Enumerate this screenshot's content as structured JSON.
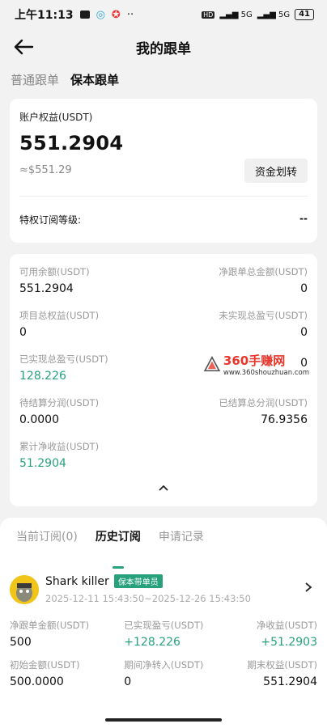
{
  "status_bar": {
    "time": "上午11:13",
    "extra": "··",
    "hd": "HD",
    "signal1": "5G",
    "signal2": "5G",
    "battery": "41"
  },
  "nav": {
    "title": "我的跟单"
  },
  "top_tabs": [
    {
      "label": "普通跟单"
    },
    {
      "label": "保本跟单"
    }
  ],
  "account": {
    "equity_label": "账户权益(USDT)",
    "equity_value": "551.2904",
    "equity_approx": "≈$551.29",
    "transfer_button": "资金划转",
    "tier_label": "特权订阅等级:",
    "tier_value": "--"
  },
  "stats": [
    {
      "left_label": "可用余额(USDT)",
      "left_value": "551.2904",
      "right_label": "净跟单总金额(USDT)",
      "right_value": "0"
    },
    {
      "left_label": "项目总权益(USDT)",
      "left_value": "0",
      "right_label": "未实现总盈亏(USDT)",
      "right_value": "0"
    },
    {
      "left_label": "已实现总盈亏(USDT)",
      "left_value": "128.226",
      "right_label": "",
      "right_value": "0"
    },
    {
      "left_label": "待结算分润(USDT)",
      "left_value": "0.0000",
      "right_label": "已结算总分润(USDT)",
      "right_value": "76.9356"
    },
    {
      "left_label": "累计净收益(USDT)",
      "left_value": "51.2904",
      "right_label": "",
      "right_value": ""
    }
  ],
  "watermark": {
    "brand": "360手赚网",
    "url": "www.360shouzhuan.com"
  },
  "bottom_tabs": [
    {
      "label": "当前订阅(0)"
    },
    {
      "label": "历史订阅"
    },
    {
      "label": "申请记录"
    }
  ],
  "trader": {
    "name": "Shark killer",
    "badge": "保本带单员",
    "dates": "2025-12-11 15:43:50~2025-12-26 15:43:50"
  },
  "trade_stats_row1": [
    {
      "label": "净跟单金额(USDT)",
      "value": "500"
    },
    {
      "label": "已实现盈亏(USDT)",
      "value": "+128.226"
    },
    {
      "label": "净收益(USDT)",
      "value": "+51.2903"
    }
  ],
  "trade_stats_row2": [
    {
      "label": "初始金额(USDT)",
      "value": "500.0000"
    },
    {
      "label": "期间净转入(USDT)",
      "value": "0"
    },
    {
      "label": "期末权益(USDT)",
      "value": "551.2904"
    }
  ],
  "colors": {
    "accent_green": "#26a17b",
    "badge_green": "#26a17b",
    "watermark_red": "#e8362a"
  }
}
